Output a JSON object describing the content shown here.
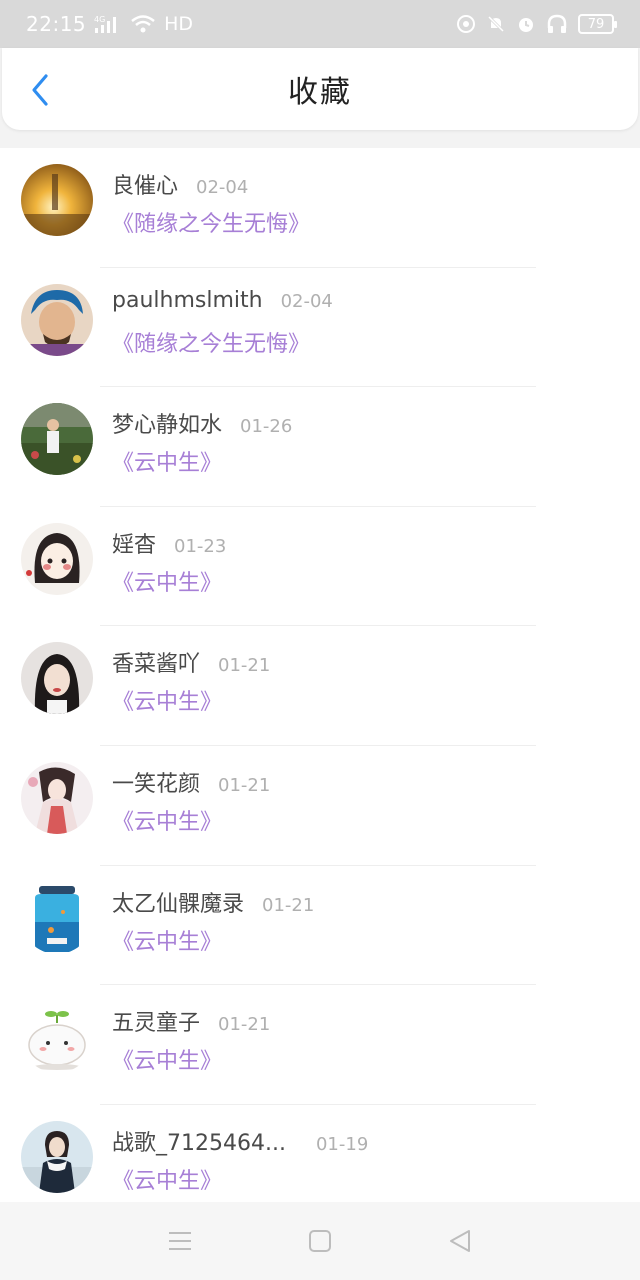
{
  "status_bar": {
    "time": "22:15",
    "network": "4G",
    "hd": "HD",
    "battery": "79"
  },
  "header": {
    "title": "收藏",
    "back_icon": "chevron-left-icon",
    "accent_color": "#2f8df0"
  },
  "items": [
    {
      "name": "良催心",
      "date": "02-04",
      "book": "《随缘之今生无悔》"
    },
    {
      "name": "paulhmslmith",
      "date": "02-04",
      "book": "《随缘之今生无悔》"
    },
    {
      "name": "梦心静如水",
      "date": "01-26",
      "book": "《云中生》"
    },
    {
      "name": "婬杳",
      "date": "01-23",
      "book": "《云中生》"
    },
    {
      "name": "香菜酱吖",
      "date": "01-21",
      "book": "《云中生》"
    },
    {
      "name": "一笑花颜",
      "date": "01-21",
      "book": "《云中生》"
    },
    {
      "name": "太乙仙髁魔录",
      "date": "01-21",
      "book": "《云中生》"
    },
    {
      "name": "五灵童子",
      "date": "01-21",
      "book": "《云中生》"
    },
    {
      "name": "战歌_7125464...",
      "date": "01-19",
      "book": "《云中生》"
    }
  ],
  "colors": {
    "book_title": "#a77fd6",
    "name": "#4a4a4a",
    "date": "#b0b0b0"
  },
  "navbar": {
    "icons": [
      "menu-icon",
      "home-square-icon",
      "back-triangle-icon"
    ]
  }
}
